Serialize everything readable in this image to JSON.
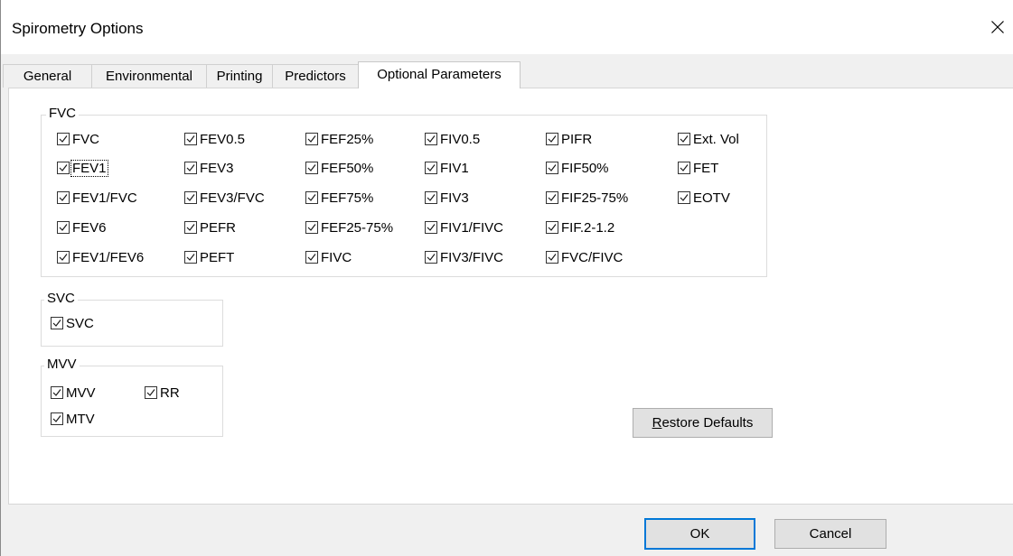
{
  "window": {
    "title": "Spirometry Options"
  },
  "tabs": [
    {
      "label": "General",
      "active": false
    },
    {
      "label": "Environmental",
      "active": false
    },
    {
      "label": "Printing",
      "active": false
    },
    {
      "label": "Predictors",
      "active": false
    },
    {
      "label": "Optional Parameters",
      "active": true
    }
  ],
  "fvc": {
    "label": "FVC",
    "columns": [
      [
        {
          "label": "FVC",
          "checked": true
        },
        {
          "label": "FEV1",
          "checked": true,
          "focused": true
        },
        {
          "label": "FEV1/FVC",
          "checked": true
        },
        {
          "label": "FEV6",
          "checked": true
        },
        {
          "label": "FEV1/FEV6",
          "checked": true
        }
      ],
      [
        {
          "label": "FEV0.5",
          "checked": true
        },
        {
          "label": "FEV3",
          "checked": true
        },
        {
          "label": "FEV3/FVC",
          "checked": true
        },
        {
          "label": "PEFR",
          "checked": true
        },
        {
          "label": "PEFT",
          "checked": true
        }
      ],
      [
        {
          "label": "FEF25%",
          "checked": true
        },
        {
          "label": "FEF50%",
          "checked": true
        },
        {
          "label": "FEF75%",
          "checked": true
        },
        {
          "label": "FEF25-75%",
          "checked": true
        },
        {
          "label": "FIVC",
          "checked": true
        }
      ],
      [
        {
          "label": "FIV0.5",
          "checked": true
        },
        {
          "label": "FIV1",
          "checked": true
        },
        {
          "label": "FIV3",
          "checked": true
        },
        {
          "label": "FIV1/FIVC",
          "checked": true
        },
        {
          "label": "FIV3/FIVC",
          "checked": true
        }
      ],
      [
        {
          "label": "PIFR",
          "checked": true
        },
        {
          "label": "FIF50%",
          "checked": true
        },
        {
          "label": "FIF25-75%",
          "checked": true
        },
        {
          "label": "FIF.2-1.2",
          "checked": true
        },
        {
          "label": "FVC/FIVC",
          "checked": true
        }
      ],
      [
        {
          "label": "Ext. Vol",
          "checked": true
        },
        {
          "label": "FET",
          "checked": true
        },
        {
          "label": "EOTV",
          "checked": true
        }
      ]
    ]
  },
  "svc": {
    "label": "SVC",
    "items": [
      {
        "label": "SVC",
        "checked": true
      }
    ]
  },
  "mvv": {
    "label": "MVV",
    "items": [
      {
        "label": "MVV",
        "checked": true
      },
      {
        "label": "RR",
        "checked": true
      },
      {
        "label": "MTV",
        "checked": true
      }
    ]
  },
  "buttons": {
    "restore_first": "R",
    "restore_rest": "estore Defaults",
    "ok": "OK",
    "cancel": "Cancel"
  }
}
